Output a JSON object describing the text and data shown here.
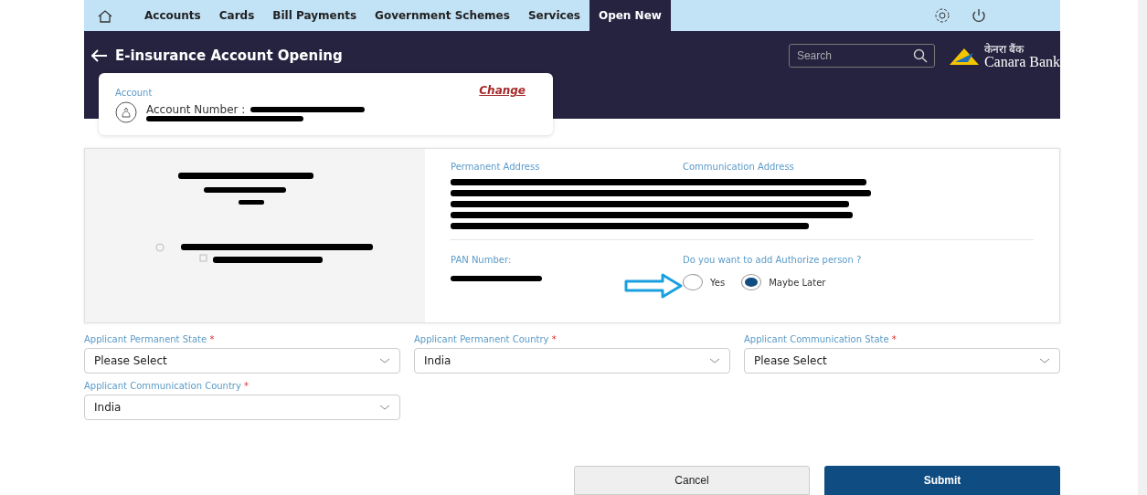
{
  "nav": {
    "tabs": [
      {
        "label": "Accounts",
        "selected": false
      },
      {
        "label": "Cards",
        "selected": false
      },
      {
        "label": "Bill Payments",
        "selected": false
      },
      {
        "label": "Government Schemes",
        "selected": false
      },
      {
        "label": "Services",
        "selected": false
      },
      {
        "label": "Open New",
        "selected": true
      }
    ]
  },
  "header": {
    "title": "E-insurance Account Opening",
    "search": {
      "placeholder": "Search"
    },
    "logo": {
      "line_1": "केनरा बैंक",
      "line_2": "Canara Bank"
    }
  },
  "account_card": {
    "label": "Account",
    "account_number_label": "Account Number :",
    "change_link": "Change"
  },
  "details": {
    "permanent_address_label": "Permanent Address",
    "communication_address_label": "Communication Address",
    "pan_label": "PAN Number:",
    "authorize_question": "Do you want to add Authorize person ?",
    "authorize_options": [
      {
        "label": "Yes",
        "selected": false
      },
      {
        "label": "Maybe Later",
        "selected": true
      }
    ]
  },
  "fields": [
    {
      "label": "Applicant Permanent State",
      "required_mark": "*",
      "value": "Please Select"
    },
    {
      "label": "Applicant Permanent Country",
      "required_mark": "*",
      "value": "India"
    },
    {
      "label": "Applicant Communication State",
      "required_mark": "*",
      "value": "Please Select"
    },
    {
      "label": "Applicant Communication Country",
      "required_mark": "*",
      "value": "India"
    }
  ],
  "buttons": [
    {
      "label": "Cancel",
      "kind": "secondary"
    },
    {
      "label": "Submit",
      "kind": "primary"
    }
  ]
}
